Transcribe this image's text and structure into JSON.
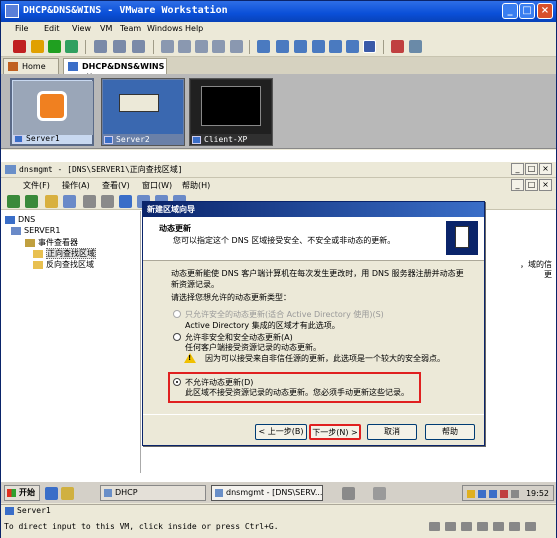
{
  "window": {
    "title": "DHCP&DNS&WINS - VMware Workstation"
  },
  "menubar": [
    "File",
    "Edit",
    "View",
    "VM",
    "Team",
    "Windows",
    "Help"
  ],
  "tabs": [
    {
      "label": "Home"
    },
    {
      "label": "DHCP&DNS&WINS",
      "close": "×"
    }
  ],
  "thumbnails": [
    {
      "label": "Server1"
    },
    {
      "label": "Server2"
    },
    {
      "label": "Client-XP"
    }
  ],
  "mmc": {
    "title": "dnsmgmt - [DNS\\SERVER1\\正向查找区域]",
    "menu": [
      "文件(F)",
      "操作(A)",
      "查看(V)",
      "窗口(W)",
      "帮助(H)"
    ],
    "tree": [
      "DNS",
      "SERVER1",
      "事件查看器",
      "正向查找区域",
      "反向查找区域"
    ],
    "right_peek": [
      "，域的信",
      "更"
    ]
  },
  "wizard": {
    "title": "新建区域向导",
    "header_title": "动态更新",
    "header_sub": "您可以指定这个 DNS 区域接受安全、不安全或非动态的更新。",
    "intro_line1": "动态更新能使 DNS 客户端计算机在每次发生更改时，用 DNS 服务器注册并动态更",
    "intro_line2": "新资源记录。",
    "prompt": "请选择您想允许的动态更新类型：",
    "options": [
      {
        "label": "只允许安全的动态更新(适合 Active Directory 使用)(S)",
        "desc": "Active Directory 集成的区域才有此选项。",
        "state": "disabled"
      },
      {
        "label": "允许非安全和安全动态更新(A)",
        "desc": "任何客户端接受资源记录的动态更新。",
        "warning": "因为可以接受来自非信任源的更新，此选项是一个较大的安全弱点。",
        "state": "unchecked"
      },
      {
        "label": "不允许动态更新(D)",
        "desc": "此区域不接受资源记录的动态更新。您必须手动更新这些记录。",
        "state": "checked"
      }
    ],
    "buttons": {
      "back": "< 上一步(B)",
      "next": "下一步(N) >",
      "cancel": "取消",
      "help": "帮助"
    }
  },
  "taskbar": {
    "start": "开始",
    "tasks": [
      "DHCP",
      "dnsmgmt - [DNS\\SERV..."
    ],
    "clock": "19:52"
  },
  "status": {
    "vm_name": "Server1",
    "message": "To direct input to this VM, click inside or press Ctrl+G."
  },
  "colors": {
    "titlebar": "#0a4fd8",
    "highlight": "#e02020",
    "dialog_face": "#ece9d8"
  }
}
